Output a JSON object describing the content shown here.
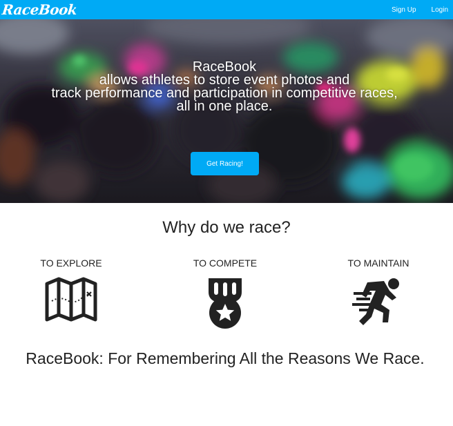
{
  "navbar": {
    "brand": "RaceBook",
    "links": [
      {
        "label": "Sign Up"
      },
      {
        "label": "Login"
      }
    ],
    "accent_color": "#00aaf5"
  },
  "hero": {
    "title": "RaceBook",
    "lines": [
      "allows athletes to store event photos and",
      "track performance and participation in competitive races,",
      "all in one place."
    ],
    "cta_label": "Get Racing!"
  },
  "why": {
    "heading": "Why do we race?",
    "reasons": [
      {
        "label": "TO EXPLORE",
        "icon": "map-icon"
      },
      {
        "label": "TO COMPETE",
        "icon": "medal-icon"
      },
      {
        "label": "TO MAINTAIN",
        "icon": "runner-icon"
      }
    ]
  },
  "tagline": "RaceBook: For Remembering All the Reasons We Race."
}
